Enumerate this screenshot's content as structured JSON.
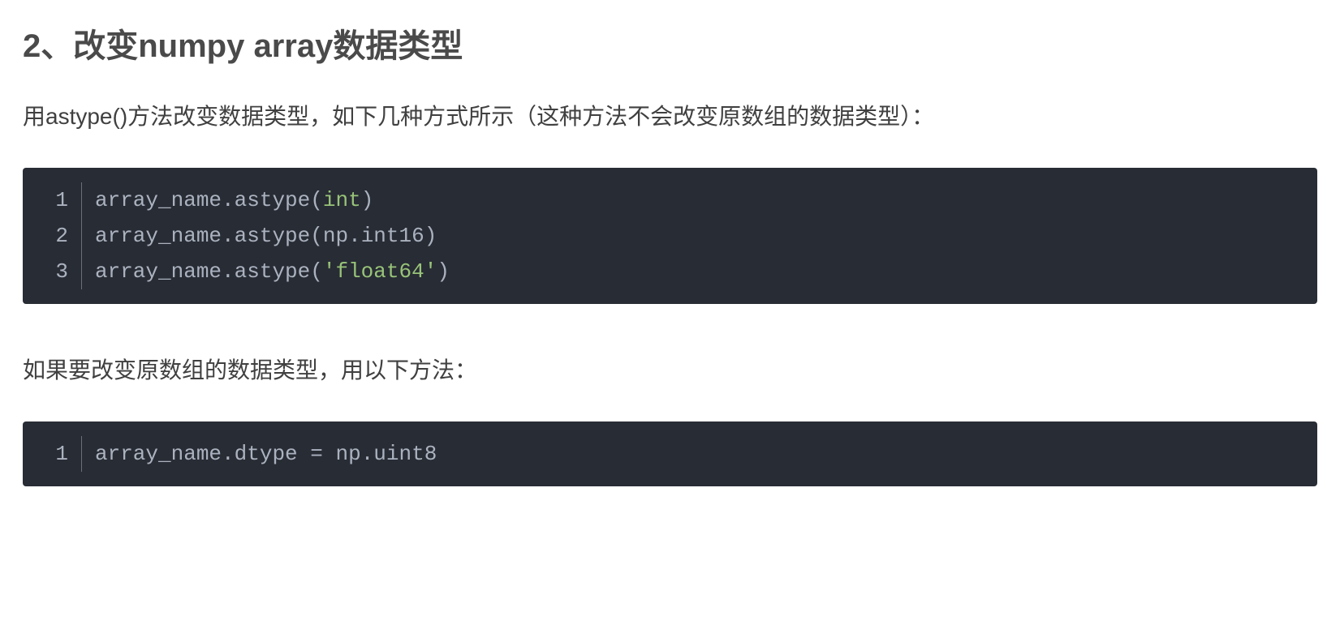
{
  "heading": "2、改变numpy array数据类型",
  "para1": "用astype()方法改变数据类型，如下几种方式所示（这种方法不会改变原数组的数据类型）：",
  "para2": "如果要改变原数组的数据类型，用以下方法：",
  "codeblock1": {
    "lines": [
      {
        "no": "1",
        "tokens": [
          {
            "t": "array_name",
            "c": "tok-default"
          },
          {
            "t": ".",
            "c": "tok-punct"
          },
          {
            "t": "astype",
            "c": "tok-default"
          },
          {
            "t": "(",
            "c": "tok-punct"
          },
          {
            "t": "int",
            "c": "tok-builtin"
          },
          {
            "t": ")",
            "c": "tok-punct"
          }
        ]
      },
      {
        "no": "2",
        "tokens": [
          {
            "t": "array_name",
            "c": "tok-default"
          },
          {
            "t": ".",
            "c": "tok-punct"
          },
          {
            "t": "astype",
            "c": "tok-default"
          },
          {
            "t": "(",
            "c": "tok-punct"
          },
          {
            "t": "np",
            "c": "tok-default"
          },
          {
            "t": ".",
            "c": "tok-punct"
          },
          {
            "t": "int16",
            "c": "tok-default"
          },
          {
            "t": ")",
            "c": "tok-punct"
          }
        ]
      },
      {
        "no": "3",
        "tokens": [
          {
            "t": "array_name",
            "c": "tok-default"
          },
          {
            "t": ".",
            "c": "tok-punct"
          },
          {
            "t": "astype",
            "c": "tok-default"
          },
          {
            "t": "(",
            "c": "tok-punct"
          },
          {
            "t": "'float64'",
            "c": "tok-string"
          },
          {
            "t": ")",
            "c": "tok-punct"
          }
        ]
      }
    ]
  },
  "codeblock2": {
    "lines": [
      {
        "no": "1",
        "tokens": [
          {
            "t": "array_name",
            "c": "tok-default"
          },
          {
            "t": ".",
            "c": "tok-punct"
          },
          {
            "t": "dtype ",
            "c": "tok-default"
          },
          {
            "t": "=",
            "c": "tok-punct"
          },
          {
            "t": " np",
            "c": "tok-default"
          },
          {
            "t": ".",
            "c": "tok-punct"
          },
          {
            "t": "uint8",
            "c": "tok-default"
          }
        ]
      }
    ]
  }
}
